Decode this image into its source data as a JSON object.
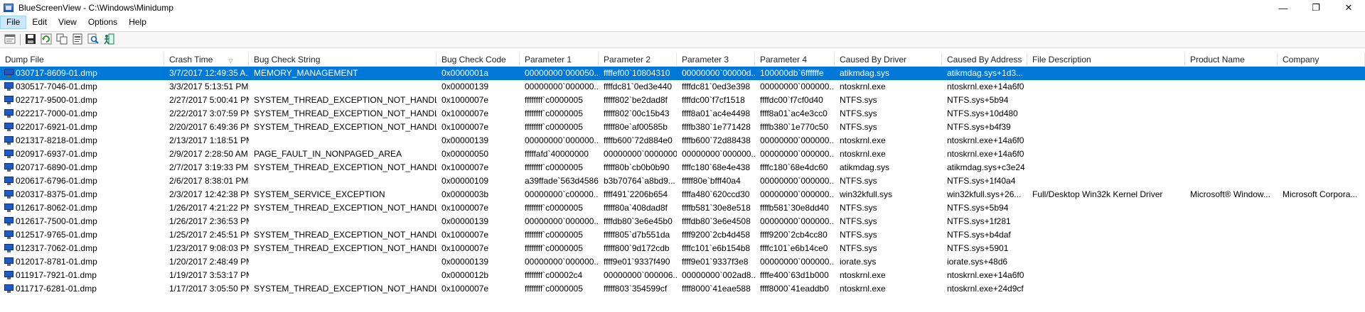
{
  "window": {
    "title": "BlueScreenView - C:\\Windows\\Minidump",
    "controls": {
      "minimize": "—",
      "maximize": "❐",
      "close": "✕"
    }
  },
  "menu": [
    {
      "label": "File",
      "active": true
    },
    {
      "label": "Edit",
      "active": false
    },
    {
      "label": "View",
      "active": false
    },
    {
      "label": "Options",
      "active": false
    },
    {
      "label": "Help",
      "active": false
    }
  ],
  "toolbar": {
    "buttons": [
      {
        "name": "properties-icon",
        "color": "#6b6b6b"
      },
      {
        "name": "save-icon",
        "color": "#2a2a2a"
      },
      {
        "name": "refresh-icon",
        "color": "#2e8b2e"
      },
      {
        "name": "copy-icon",
        "color": "#555555"
      },
      {
        "name": "report-icon",
        "color": "#555555"
      },
      {
        "name": "find-icon",
        "color": "#1a5fb4"
      },
      {
        "name": "exit-icon",
        "color": "#1a7a5a"
      }
    ]
  },
  "columns": [
    {
      "key": "dump_file",
      "label": "Dump File"
    },
    {
      "key": "crash_time",
      "label": "Crash Time",
      "sorted": true
    },
    {
      "key": "bug_check_string",
      "label": "Bug Check String"
    },
    {
      "key": "bug_check_code",
      "label": "Bug Check Code"
    },
    {
      "key": "parameter_1",
      "label": "Parameter 1"
    },
    {
      "key": "parameter_2",
      "label": "Parameter 2"
    },
    {
      "key": "parameter_3",
      "label": "Parameter 3"
    },
    {
      "key": "parameter_4",
      "label": "Parameter 4"
    },
    {
      "key": "caused_by_driver",
      "label": "Caused By Driver"
    },
    {
      "key": "caused_by_address",
      "label": "Caused By Address"
    },
    {
      "key": "file_description",
      "label": "File Description"
    },
    {
      "key": "product_name",
      "label": "Product Name"
    },
    {
      "key": "company",
      "label": "Company"
    }
  ],
  "rows": [
    {
      "selected": true,
      "dump_file": "030717-8609-01.dmp",
      "crash_time": "3/7/2017 12:49:35 A...",
      "bug_check_string": "MEMORY_MANAGEMENT",
      "bug_check_code": "0x0000001a",
      "parameter_1": "00000000`000050...",
      "parameter_2": "ffffef00`10804310",
      "parameter_3": "00000000`00000d...",
      "parameter_4": "100000db`6ffffffe",
      "caused_by_driver": "atikmdag.sys",
      "caused_by_address": "atikmdag.sys+1d3...",
      "file_description": "",
      "product_name": "",
      "company": ""
    },
    {
      "selected": false,
      "dump_file": "030517-7046-01.dmp",
      "crash_time": "3/3/2017 5:13:51 PM",
      "bug_check_string": "",
      "bug_check_code": "0x00000139",
      "parameter_1": "00000000`000000...",
      "parameter_2": "ffffdc81`0ed3e440",
      "parameter_3": "ffffdc81`0ed3e398",
      "parameter_4": "00000000`000000...",
      "caused_by_driver": "ntoskrnl.exe",
      "caused_by_address": "ntoskrnl.exe+14a6f0",
      "file_description": "",
      "product_name": "",
      "company": ""
    },
    {
      "selected": false,
      "dump_file": "022717-9500-01.dmp",
      "crash_time": "2/27/2017 5:00:41 PM",
      "bug_check_string": "SYSTEM_THREAD_EXCEPTION_NOT_HANDLED",
      "bug_check_code": "0x1000007e",
      "parameter_1": "ffffffff`c0000005",
      "parameter_2": "fffff802`be2dad8f",
      "parameter_3": "ffffdc00`f7cf1518",
      "parameter_4": "ffffdc00`f7cf0d40",
      "caused_by_driver": "NTFS.sys",
      "caused_by_address": "NTFS.sys+5b94",
      "file_description": "",
      "product_name": "",
      "company": ""
    },
    {
      "selected": false,
      "dump_file": "022217-7000-01.dmp",
      "crash_time": "2/22/2017 3:07:59 PM",
      "bug_check_string": "SYSTEM_THREAD_EXCEPTION_NOT_HANDLED",
      "bug_check_code": "0x1000007e",
      "parameter_1": "ffffffff`c0000005",
      "parameter_2": "fffff802`00c15b43",
      "parameter_3": "ffff8a01`ac4e4498",
      "parameter_4": "ffff8a01`ac4e3cc0",
      "caused_by_driver": "NTFS.sys",
      "caused_by_address": "NTFS.sys+10d480",
      "file_description": "",
      "product_name": "",
      "company": ""
    },
    {
      "selected": false,
      "dump_file": "022017-6921-01.dmp",
      "crash_time": "2/20/2017 6:49:36 PM",
      "bug_check_string": "SYSTEM_THREAD_EXCEPTION_NOT_HANDLED",
      "bug_check_code": "0x1000007e",
      "parameter_1": "ffffffff`c0000005",
      "parameter_2": "fffff80e`af00585b",
      "parameter_3": "ffffb380`1e771428",
      "parameter_4": "ffffb380`1e770c50",
      "caused_by_driver": "NTFS.sys",
      "caused_by_address": "NTFS.sys+b4f39",
      "file_description": "",
      "product_name": "",
      "company": ""
    },
    {
      "selected": false,
      "dump_file": "021317-8218-01.dmp",
      "crash_time": "2/13/2017 1:18:51 PM",
      "bug_check_string": "",
      "bug_check_code": "0x00000139",
      "parameter_1": "00000000`000000...",
      "parameter_2": "ffffb600`72d884e0",
      "parameter_3": "ffffb600`72d88438",
      "parameter_4": "00000000`000000...",
      "caused_by_driver": "ntoskrnl.exe",
      "caused_by_address": "ntoskrnl.exe+14a6f0",
      "file_description": "",
      "product_name": "",
      "company": ""
    },
    {
      "selected": false,
      "dump_file": "020917-6937-01.dmp",
      "crash_time": "2/9/2017 2:28:50 AM",
      "bug_check_string": "PAGE_FAULT_IN_NONPAGED_AREA",
      "bug_check_code": "0x00000050",
      "parameter_1": "fffffafd`40000000",
      "parameter_2": "00000000`00000000",
      "parameter_3": "00000000`000000...",
      "parameter_4": "00000000`000000...",
      "caused_by_driver": "ntoskrnl.exe",
      "caused_by_address": "ntoskrnl.exe+14a6f0",
      "file_description": "",
      "product_name": "",
      "company": ""
    },
    {
      "selected": false,
      "dump_file": "020717-6890-01.dmp",
      "crash_time": "2/7/2017 3:19:33 PM",
      "bug_check_string": "SYSTEM_THREAD_EXCEPTION_NOT_HANDLED",
      "bug_check_code": "0x1000007e",
      "parameter_1": "ffffffff`c0000005",
      "parameter_2": "fffff80b`cb0b0b90",
      "parameter_3": "ffffc180`68e4e438",
      "parameter_4": "ffffc180`68e4dc60",
      "caused_by_driver": "atikmdag.sys",
      "caused_by_address": "atikmdag.sys+c3e24",
      "file_description": "",
      "product_name": "",
      "company": ""
    },
    {
      "selected": false,
      "dump_file": "020617-6796-01.dmp",
      "crash_time": "2/6/2017 8:38:01 PM",
      "bug_check_string": "",
      "bug_check_code": "0x00000109",
      "parameter_1": "a39ffade`563d4586",
      "parameter_2": "b3b70764`a8bd9...",
      "parameter_3": "fffff80e`bfff40a4",
      "parameter_4": "00000000`000000...",
      "caused_by_driver": "NTFS.sys",
      "caused_by_address": "NTFS.sys+1f40a4",
      "file_description": "",
      "product_name": "",
      "company": ""
    },
    {
      "selected": false,
      "dump_file": "020317-8375-01.dmp",
      "crash_time": "2/3/2017 12:42:38 PM",
      "bug_check_string": "SYSTEM_SERVICE_EXCEPTION",
      "bug_check_code": "0x0000003b",
      "parameter_1": "00000000`c00000...",
      "parameter_2": "ffff491`2206b654",
      "parameter_3": "ffffa480`620ccd30",
      "parameter_4": "00000000`000000...",
      "caused_by_driver": "win32kfull.sys",
      "caused_by_address": "win32kfull.sys+26...",
      "file_description": "Full/Desktop Win32k Kernel Driver",
      "product_name": "Microsoft® Window...",
      "company": "Microsoft Corpora..."
    },
    {
      "selected": false,
      "dump_file": "012617-8062-01.dmp",
      "crash_time": "1/26/2017 4:21:22 PM",
      "bug_check_string": "SYSTEM_THREAD_EXCEPTION_NOT_HANDLED",
      "bug_check_code": "0x1000007e",
      "parameter_1": "ffffffff`c0000005",
      "parameter_2": "fffff80a`408dad8f",
      "parameter_3": "ffffb581`30e8e518",
      "parameter_4": "ffffb581`30e8dd40",
      "caused_by_driver": "NTFS.sys",
      "caused_by_address": "NTFS.sys+5b94",
      "file_description": "",
      "product_name": "",
      "company": ""
    },
    {
      "selected": false,
      "dump_file": "012617-7500-01.dmp",
      "crash_time": "1/26/2017 2:36:53 PM",
      "bug_check_string": "",
      "bug_check_code": "0x00000139",
      "parameter_1": "00000000`000000...",
      "parameter_2": "ffffdb80`3e6e45b0",
      "parameter_3": "ffffdb80`3e6e4508",
      "parameter_4": "00000000`000000...",
      "caused_by_driver": "NTFS.sys",
      "caused_by_address": "NTFS.sys+1f281",
      "file_description": "",
      "product_name": "",
      "company": ""
    },
    {
      "selected": false,
      "dump_file": "012517-9765-01.dmp",
      "crash_time": "1/25/2017 2:45:51 PM",
      "bug_check_string": "SYSTEM_THREAD_EXCEPTION_NOT_HANDLED",
      "bug_check_code": "0x1000007e",
      "parameter_1": "ffffffff`c0000005",
      "parameter_2": "fffff805`d7b551da",
      "parameter_3": "ffff9200`2cb4d458",
      "parameter_4": "ffff9200`2cb4cc80",
      "caused_by_driver": "NTFS.sys",
      "caused_by_address": "NTFS.sys+b4daf",
      "file_description": "",
      "product_name": "",
      "company": ""
    },
    {
      "selected": false,
      "dump_file": "012317-7062-01.dmp",
      "crash_time": "1/23/2017 9:08:03 PM",
      "bug_check_string": "SYSTEM_THREAD_EXCEPTION_NOT_HANDLED",
      "bug_check_code": "0x1000007e",
      "parameter_1": "ffffffff`c0000005",
      "parameter_2": "fffff800`9d172cdb",
      "parameter_3": "ffffc101`e6b154b8",
      "parameter_4": "ffffc101`e6b14ce0",
      "caused_by_driver": "NTFS.sys",
      "caused_by_address": "NTFS.sys+5901",
      "file_description": "",
      "product_name": "",
      "company": ""
    },
    {
      "selected": false,
      "dump_file": "012017-8781-01.dmp",
      "crash_time": "1/20/2017 2:48:49 PM",
      "bug_check_string": "",
      "bug_check_code": "0x00000139",
      "parameter_1": "00000000`000000...",
      "parameter_2": "ffff9e01`9337f490",
      "parameter_3": "ffff9e01`9337f3e8",
      "parameter_4": "00000000`000000...",
      "caused_by_driver": "iorate.sys",
      "caused_by_address": "iorate.sys+48d6",
      "file_description": "",
      "product_name": "",
      "company": ""
    },
    {
      "selected": false,
      "dump_file": "011917-7921-01.dmp",
      "crash_time": "1/19/2017 3:53:17 PM",
      "bug_check_string": "",
      "bug_check_code": "0x0000012b",
      "parameter_1": "ffffffff`c00002c4",
      "parameter_2": "00000000`000006...",
      "parameter_3": "00000000`002ad8...",
      "parameter_4": "ffffe400`63d1b000",
      "caused_by_driver": "ntoskrnl.exe",
      "caused_by_address": "ntoskrnl.exe+14a6f0",
      "file_description": "",
      "product_name": "",
      "company": ""
    },
    {
      "selected": false,
      "dump_file": "011717-6281-01.dmp",
      "crash_time": "1/17/2017 3:05:50 PM",
      "bug_check_string": "SYSTEM_THREAD_EXCEPTION_NOT_HANDLED",
      "bug_check_code": "0x1000007e",
      "parameter_1": "ffffffff`c0000005",
      "parameter_2": "fffff803`354599cf",
      "parameter_3": "ffff8000`41eae588",
      "parameter_4": "ffff8000`41eaddb0",
      "caused_by_driver": "ntoskrnl.exe",
      "caused_by_address": "ntoskrnl.exe+24d9cf",
      "file_description": "",
      "product_name": "",
      "company": ""
    }
  ]
}
